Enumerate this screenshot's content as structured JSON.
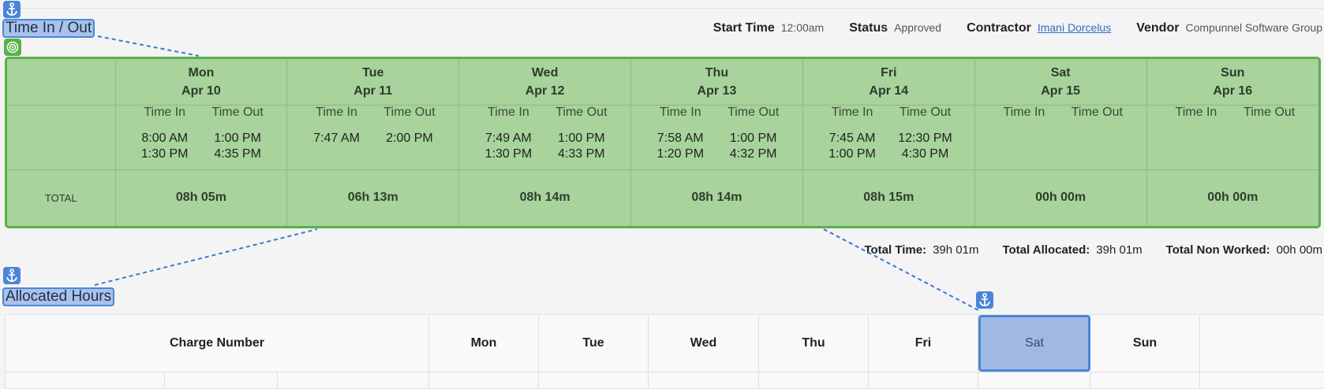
{
  "annotations": {
    "time_in_out_label": "Time In / Out",
    "allocated_hours_label": "Allocated Hours"
  },
  "header": {
    "start_time_label": "Start Time",
    "start_time_value": "12:00am",
    "status_label": "Status",
    "status_value": "Approved",
    "contractor_label": "Contractor",
    "contractor_value": "Imani Dorcelus",
    "vendor_label": "Vendor",
    "vendor_value": "Compunnel Software Group"
  },
  "time_table": {
    "time_in_label": "Time In",
    "time_out_label": "Time Out",
    "total_label": "TOTAL",
    "days": [
      {
        "day": "Mon",
        "date": "Apr 10",
        "in": [
          "8:00 AM",
          "1:30 PM"
        ],
        "out": [
          "1:00 PM",
          "4:35 PM"
        ],
        "total": "08h 05m"
      },
      {
        "day": "Tue",
        "date": "Apr 11",
        "in": [
          "7:47 AM"
        ],
        "out": [
          "2:00 PM"
        ],
        "total": "06h 13m"
      },
      {
        "day": "Wed",
        "date": "Apr 12",
        "in": [
          "7:49 AM",
          "1:30 PM"
        ],
        "out": [
          "1:00 PM",
          "4:33 PM"
        ],
        "total": "08h 14m"
      },
      {
        "day": "Thu",
        "date": "Apr 13",
        "in": [
          "7:58 AM",
          "1:20 PM"
        ],
        "out": [
          "1:00 PM",
          "4:32 PM"
        ],
        "total": "08h 14m"
      },
      {
        "day": "Fri",
        "date": "Apr 14",
        "in": [
          "7:45 AM",
          "1:00 PM"
        ],
        "out": [
          "12:30 PM",
          "4:30 PM"
        ],
        "total": "08h 15m"
      },
      {
        "day": "Sat",
        "date": "Apr 15",
        "in": [],
        "out": [],
        "total": "00h 00m"
      },
      {
        "day": "Sun",
        "date": "Apr 16",
        "in": [],
        "out": [],
        "total": "00h 00m"
      }
    ]
  },
  "totals": {
    "total_time_label": "Total Time:",
    "total_time_value": "39h 01m",
    "total_allocated_label": "Total Allocated:",
    "total_allocated_value": "39h 01m",
    "total_non_worked_label": "Total Non Worked:",
    "total_non_worked_value": "00h 00m"
  },
  "allocated_table": {
    "charge_number_label": "Charge Number",
    "days": [
      "Mon",
      "Tue",
      "Wed",
      "Thu",
      "Fri",
      "Sat",
      "Sun"
    ],
    "selected_day": "Sat"
  },
  "colors": {
    "highlight_blue": "#4a86d8",
    "highlight_green": "#5ab04a",
    "link": "#2a6fc9"
  },
  "icons": [
    "anchor-icon",
    "target-icon"
  ]
}
